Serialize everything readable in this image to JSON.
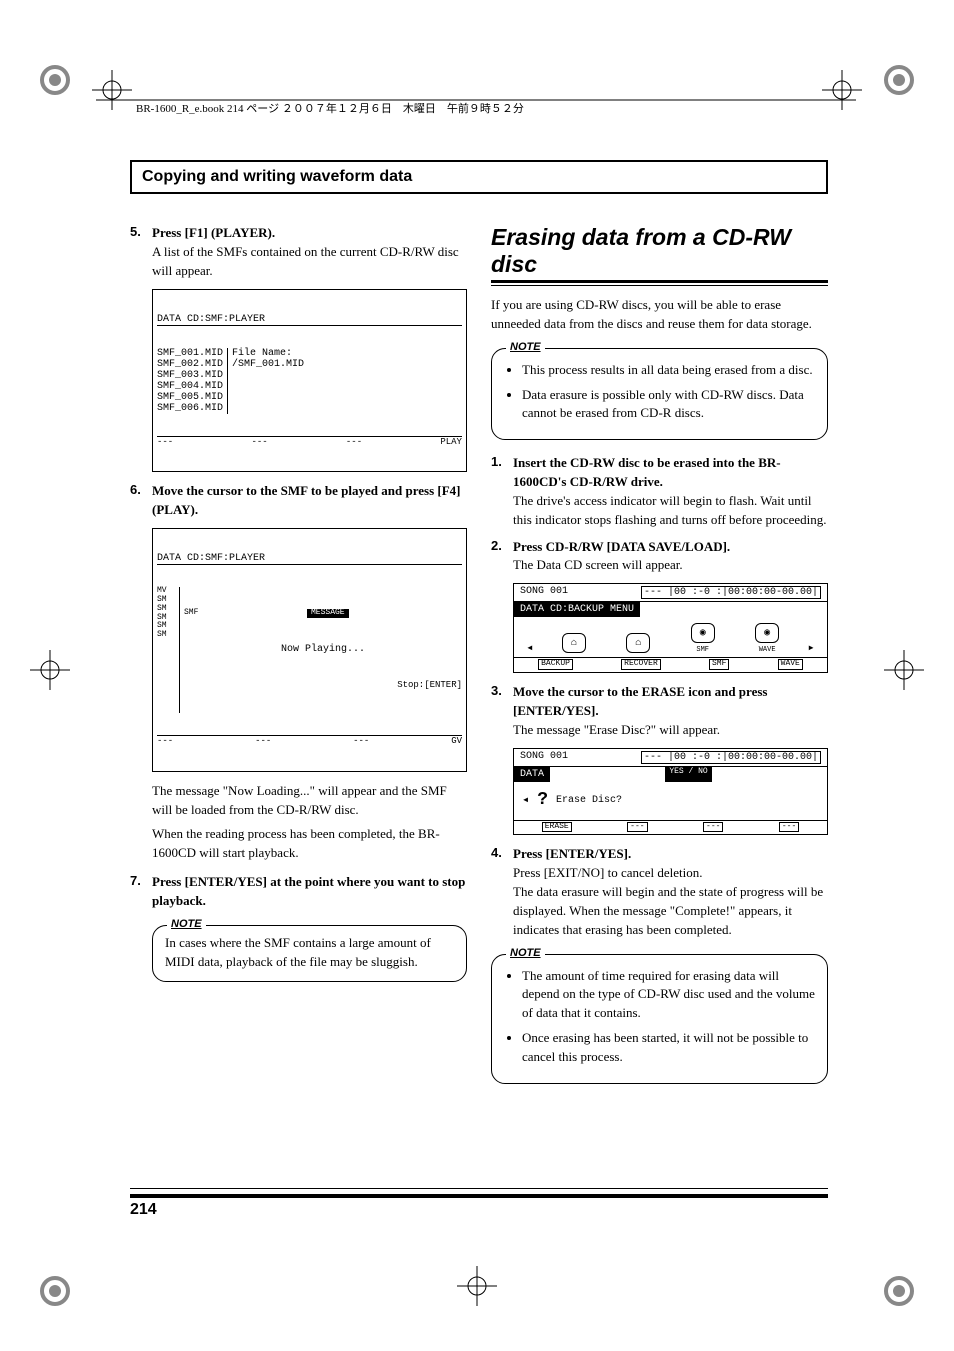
{
  "header_text": "BR-1600_R_e.book 214 ページ ２００７年１２月６日　木曜日　午前９時５２分",
  "section_bar": "Copying and writing waveform data",
  "left": {
    "step5": {
      "num": "5.",
      "head": "Press [F1] (PLAYER).",
      "body": "A list of the SMFs contained on the current CD-R/RW disc will appear."
    },
    "lcd1": {
      "title": "DATA CD:SMF:PLAYER",
      "files": "SMF_001.MID\nSMF_002.MID\nSMF_003.MID\nSMF_004.MID\nSMF_005.MID\nSMF_006.MID",
      "right": "File Name:\n/SMF_001.MID",
      "bot": [
        "---",
        "---",
        "---",
        "PLAY"
      ]
    },
    "step6": {
      "num": "6.",
      "head": "Move the cursor to the SMF to be played and press [F4] (PLAY)."
    },
    "lcd2": {
      "title": "DATA CD:SMF:PLAYER",
      "left": "MV\nSM\nSM\nSM\nSM\nSM",
      "mid_label": "SMF",
      "msg_label": "MESSAGE",
      "msg": "Now Playing...",
      "stop": "Stop:[ENTER]",
      "bot": [
        "---",
        "---",
        "---",
        "GV"
      ]
    },
    "after2_a": "The message \"Now Loading...\" will appear and the SMF will be loaded from the CD-R/RW disc.",
    "after2_b": "When the reading process has been completed, the BR-1600CD will start playback.",
    "step7": {
      "num": "7.",
      "head": "Press [ENTER/YES] at the point where you want to stop playback."
    },
    "note": {
      "label": "NOTE",
      "text": "In cases where the SMF contains a large amount of MIDI data, playback of the file may be sluggish."
    }
  },
  "right": {
    "title": "Erasing data from a CD-RW disc",
    "intro": "If you are using CD-RW discs, you will be able to erase unneeded data from the discs and reuse them for data storage.",
    "note1": {
      "label": "NOTE",
      "items": [
        "This process results in all data being erased from a disc.",
        "Data erasure is possible only with CD-RW discs. Data cannot be erased from CD-R discs."
      ]
    },
    "step1": {
      "num": "1.",
      "head": "Insert the CD-RW disc to be erased into the BR-1600CD's CD-R/RW drive.",
      "body": "The drive's access indicator will begin to flash. Wait until this indicator stops flashing and turns off before proceeding."
    },
    "step2": {
      "num": "2.",
      "head": "Press CD-R/RW [DATA SAVE/LOAD].",
      "body": "The Data CD screen will appear."
    },
    "screen1": {
      "song": "SONG 001",
      "counter": "--- |00 :-0 :|00:00:00-00.00|",
      "title": "DATA CD:BACKUP MENU",
      "icons": [
        "BACKUP",
        "RECOVER",
        "SMF",
        "WAVE"
      ],
      "btns": [
        "BACKUP",
        "RECOVER",
        "SMF",
        "WAVE"
      ]
    },
    "step3": {
      "num": "3.",
      "head": "Move the cursor to the ERASE icon and press [ENTER/YES].",
      "body": "The message \"Erase Disc?\" will appear."
    },
    "screen2": {
      "song": "SONG 001",
      "counter": "--- |00 :-0 :|00:00:00-00.00|",
      "title": "DATA",
      "tab": "YES / NO",
      "msg": "Erase Disc?",
      "btns": [
        "ERASE",
        "---",
        "---",
        "---"
      ]
    },
    "step4": {
      "num": "4.",
      "head": "Press [ENTER/YES].",
      "body_a": "Press [EXIT/NO] to cancel deletion.",
      "body_b": "The data erasure will begin and the state of progress will be displayed. When the message \"Complete!\" appears, it indicates that erasing has been completed."
    },
    "note2": {
      "label": "NOTE",
      "items": [
        "The amount of time required for erasing data will depend on the type of CD-RW disc used and the volume of data that it contains.",
        "Once erasing has been started, it will not be possible to cancel this process."
      ]
    }
  },
  "page_number": "214"
}
